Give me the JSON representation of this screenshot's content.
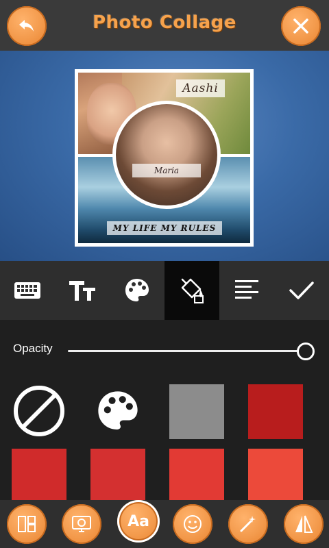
{
  "header": {
    "title": "Photo Collage",
    "back_icon": "undo-arrow-icon",
    "close_icon": "close-icon"
  },
  "collage": {
    "label_top": "Aashi",
    "label_center": "Maria",
    "label_bottom": "MY LIFE MY RULES"
  },
  "toolbar": {
    "tools": [
      {
        "icon": "keyboard-icon"
      },
      {
        "icon": "text-size-icon"
      },
      {
        "icon": "palette-icon"
      },
      {
        "icon": "paint-bucket-icon",
        "active": true
      },
      {
        "icon": "text-align-icon"
      },
      {
        "icon": "check-icon"
      }
    ]
  },
  "panel": {
    "opacity_label": "Opacity",
    "opacity_value": 1.0,
    "swatches_row1": [
      "none",
      "palette",
      "#8c8c8c",
      "#b81d1d"
    ],
    "swatches_row2": [
      "#d02b2b",
      "#d43030",
      "#e23a34",
      "#ec4a3a"
    ]
  },
  "bottom_bar": {
    "buttons": [
      {
        "icon": "layout-icon"
      },
      {
        "icon": "background-icon"
      },
      {
        "icon": "text-icon",
        "label": "Aa",
        "active": true
      },
      {
        "icon": "sticker-icon"
      },
      {
        "icon": "magic-wand-icon"
      },
      {
        "icon": "mirror-icon"
      }
    ]
  },
  "colors": {
    "accent": "#f39a4c",
    "header_bg": "#3a3a3a",
    "canvas_bg": "#3a6aa7"
  }
}
